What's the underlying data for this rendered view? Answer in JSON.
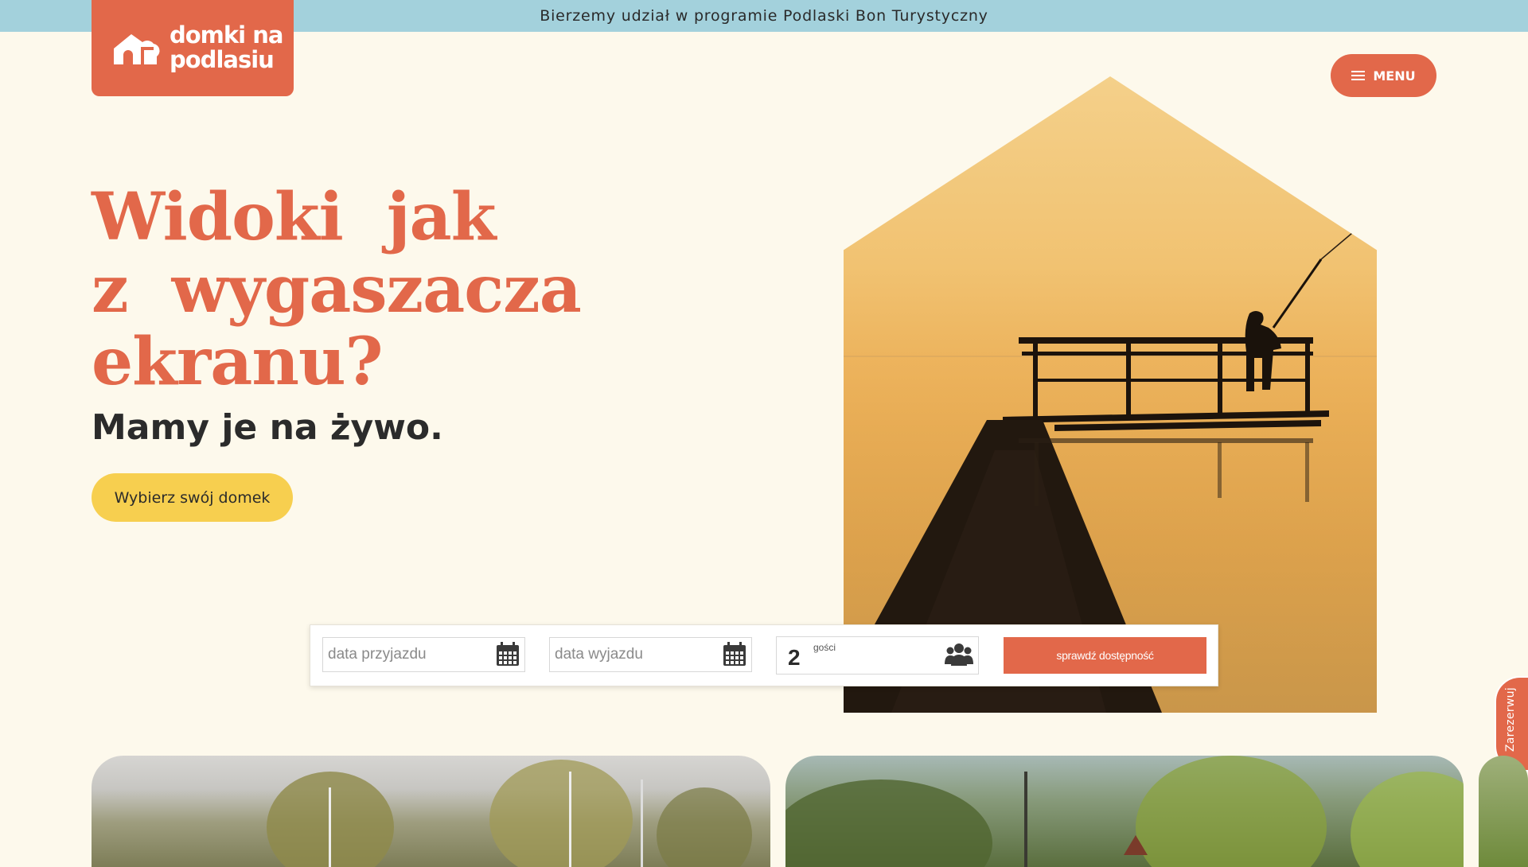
{
  "announcement": "Bierzemy udział w programie Podlaski Bon Turystyczny",
  "logo": {
    "line1": "domki na",
    "line2": "podlasiu"
  },
  "menu": {
    "label": "MENU"
  },
  "hero": {
    "title_lines": [
      "Widoki  jak",
      "z  wygaszacza",
      "ekranu?"
    ],
    "subtitle": "Mamy je na żywo.",
    "cta": "Wybierz swój domek"
  },
  "booking": {
    "arrival_placeholder": "data przyjazdu",
    "departure_placeholder": "data wyjazdu",
    "guests_count": "2",
    "guests_label": "gości",
    "submit": "sprawdź dostępność"
  },
  "reserve_tab": "Zarezerwuj",
  "colors": {
    "accent": "#e2684a",
    "announcement_bg": "#a3d1dc",
    "cta": "#f7cf4f",
    "page_bg": "#fdf9ec"
  },
  "icons": [
    "house-logo-icon",
    "hamburger-icon",
    "calendar-icon",
    "people-icon"
  ]
}
